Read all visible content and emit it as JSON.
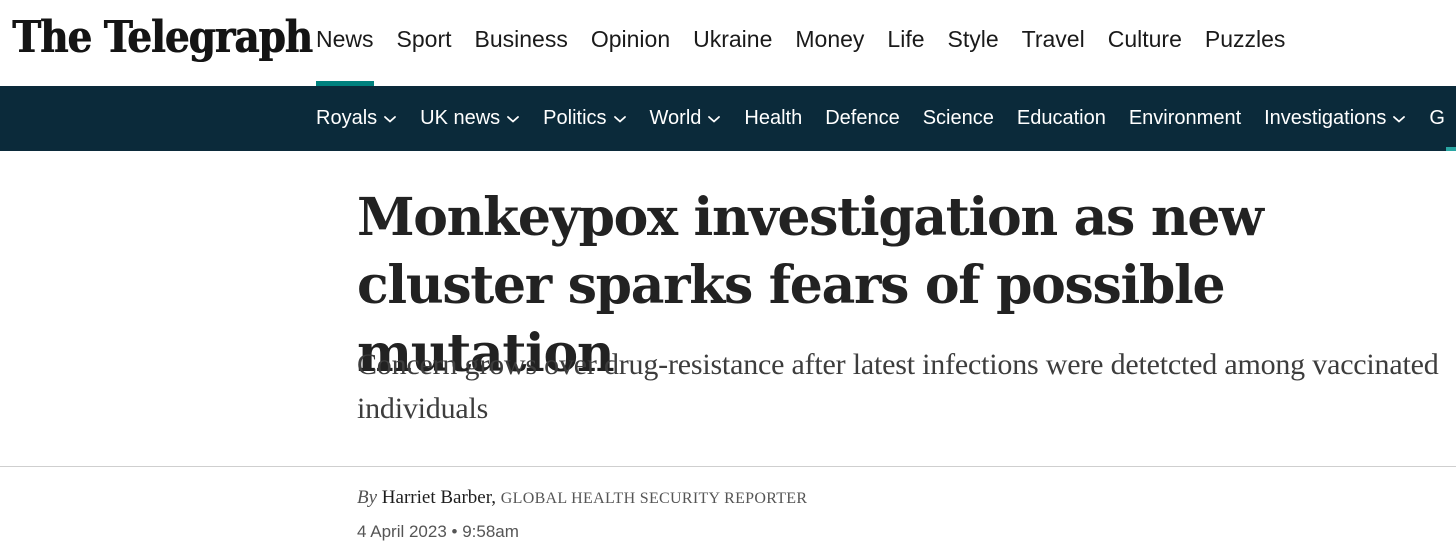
{
  "site": {
    "logo_text": "The Telegraph"
  },
  "primary_nav": [
    {
      "label": "News",
      "active": true
    },
    {
      "label": "Sport"
    },
    {
      "label": "Business"
    },
    {
      "label": "Opinion"
    },
    {
      "label": "Ukraine"
    },
    {
      "label": "Money"
    },
    {
      "label": "Life"
    },
    {
      "label": "Style"
    },
    {
      "label": "Travel"
    },
    {
      "label": "Culture"
    },
    {
      "label": "Puzzles"
    }
  ],
  "secondary_nav": [
    {
      "label": "Royals",
      "has_dropdown": true
    },
    {
      "label": "UK news",
      "has_dropdown": true
    },
    {
      "label": "Politics",
      "has_dropdown": true
    },
    {
      "label": "World",
      "has_dropdown": true
    },
    {
      "label": "Health",
      "has_dropdown": false
    },
    {
      "label": "Defence",
      "has_dropdown": false
    },
    {
      "label": "Science",
      "has_dropdown": false
    },
    {
      "label": "Education",
      "has_dropdown": false
    },
    {
      "label": "Environment",
      "has_dropdown": false
    },
    {
      "label": "Investigations",
      "has_dropdown": true
    },
    {
      "label": "G",
      "has_dropdown": false
    }
  ],
  "article": {
    "headline": "Monkeypox investigation as new cluster sparks fears of possible mutation",
    "standfirst": "Concern grows over drug-resistance after latest infections were detetcted among vaccinated individuals",
    "byline_prefix": "By",
    "author": "Harriet Barber,",
    "author_role": "GLOBAL HEALTH SECURITY REPORTER",
    "published": "4 April 2023 • 9:58am"
  },
  "colors": {
    "accent_teal": "#00817e",
    "subnav_background": "#0b2a3a",
    "headline_text": "#222222"
  }
}
